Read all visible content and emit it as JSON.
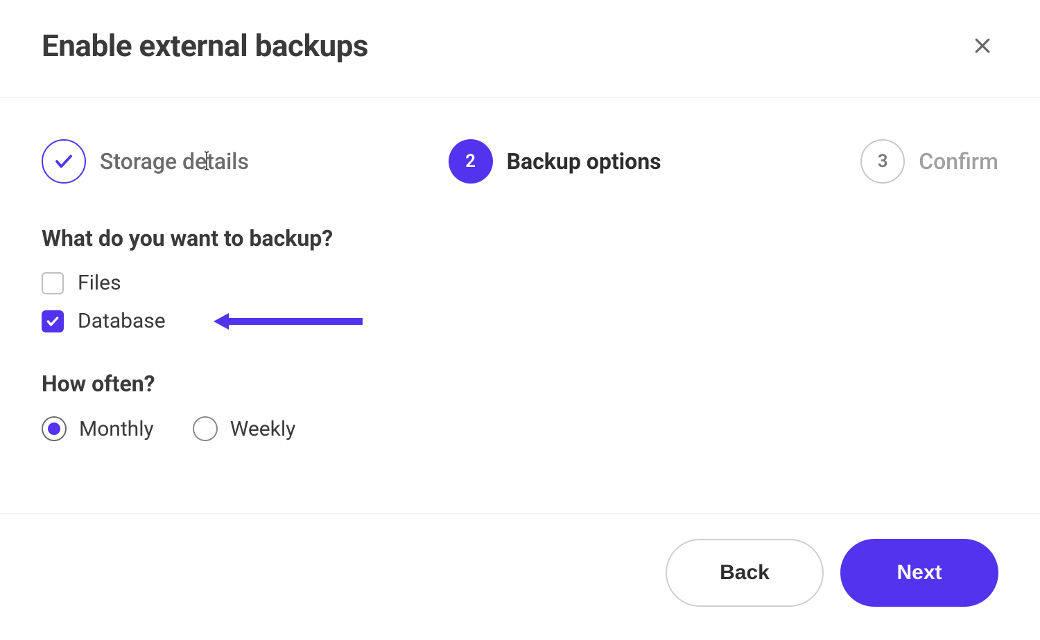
{
  "header": {
    "title": "Enable external backups"
  },
  "steps": {
    "one": {
      "label": "Storage details"
    },
    "two": {
      "number": "2",
      "label": "Backup options"
    },
    "three": {
      "number": "3",
      "label": "Confirm"
    }
  },
  "sections": {
    "what": {
      "title": "What do you want to backup?",
      "files_label": "Files",
      "database_label": "Database",
      "files_checked": false,
      "database_checked": true
    },
    "how": {
      "title": "How often?",
      "monthly_label": "Monthly",
      "weekly_label": "Weekly",
      "selected": "monthly"
    }
  },
  "footer": {
    "back_label": "Back",
    "next_label": "Next"
  },
  "colors": {
    "accent": "#5333ed"
  }
}
